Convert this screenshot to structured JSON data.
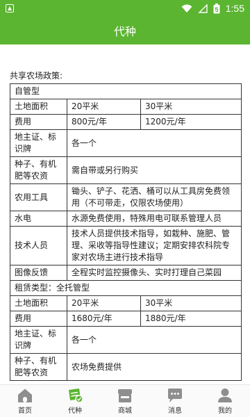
{
  "status_bar": {
    "time": "1:55",
    "battery_level": "5"
  },
  "header": {
    "title": "代种"
  },
  "policy": {
    "title": "共享农场政策:",
    "self_managed": {
      "heading": "自管型",
      "land_label": "土地面积",
      "area_a": "20平米",
      "area_b": "30平米",
      "fee_label": "费用",
      "fee_a": "800元/年",
      "fee_b": "1200元/年",
      "rows": [
        {
          "label": "地主证、标识牌",
          "value": "各一个"
        },
        {
          "label": "种子、有机肥等农资",
          "value": "需自带或另行购买"
        },
        {
          "label": "农用工具",
          "value": "锄头、铲子、花洒、桶可以从工具房免费领用（不可带走，仅限农场使用）"
        },
        {
          "label": "水电",
          "value": "水源免费使用，特殊用电可联系管理人员"
        },
        {
          "label": "技术人员",
          "value": "技术人员提供技术指导，如栽种、施肥、管理、采收等指导性建议；定期安排农科院专家对农场主进行技术指导"
        },
        {
          "label": "图像反馈",
          "value": "全程实时监控摄像头、实时打理自己菜园"
        }
      ]
    },
    "full_managed": {
      "heading": "租赁类型：全托管型",
      "land_label": "土地面积",
      "area_a": "20平米",
      "area_b": "30平米",
      "fee_label": "费用",
      "fee_a": "1680元/年",
      "fee_b": "1880元/年",
      "rows": [
        {
          "label": "地主证、标识牌",
          "value": "各一个"
        },
        {
          "label": "种子、有机肥等农资",
          "value": "农场免费提供"
        }
      ]
    }
  },
  "tabs": [
    {
      "label": "首页",
      "icon": "home-icon"
    },
    {
      "label": "代种",
      "icon": "plant-icon"
    },
    {
      "label": "商城",
      "icon": "store-icon"
    },
    {
      "label": "消息",
      "icon": "message-icon"
    },
    {
      "label": "我的",
      "icon": "user-icon"
    }
  ],
  "colors": {
    "primary": "#5bb531",
    "tab_icon": "#8e8e8e"
  }
}
